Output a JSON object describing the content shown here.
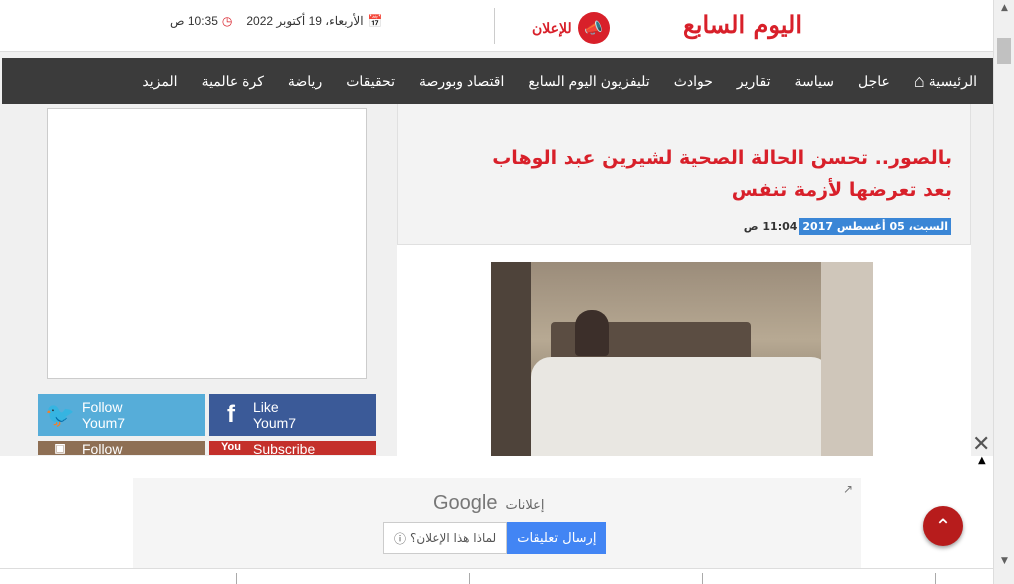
{
  "header": {
    "logo": "اليوم السابع",
    "ad_link_label": "للإعلان",
    "date": "الأربعاء، 19 أكتوبر 2022",
    "time": "10:35 ص",
    "calendar_icon": "calendar-icon",
    "clock_icon": "clock-icon"
  },
  "nav": {
    "items": [
      "الرئيسية",
      "عاجل",
      "سياسة",
      "تقارير",
      "حوادث",
      "تليفزيون اليوم السابع",
      "اقتصاد وبورصة",
      "تحقيقات",
      "رياضة",
      "كرة عالمية",
      "المزيد"
    ]
  },
  "article": {
    "title": "بالصور.. تحسن الحالة الصحية لشيرين عبد الوهاب بعد تعرضها لأزمة تنفس",
    "date": "السبت، 05 أغسطس 2017",
    "time": "11:04 ص"
  },
  "social": {
    "twitter": {
      "line1": "Follow",
      "line2": "Youm7"
    },
    "facebook": {
      "line1": "Like",
      "line2": "Youm7"
    },
    "instagram": {
      "line1": "Follow"
    },
    "youtube": {
      "line1": "Subscribe",
      "icon": "You"
    }
  },
  "ad": {
    "ads_label": "إعلانات",
    "google": "Google",
    "send_feedback": "إرسال تعليقات",
    "why_ad": "لماذا هذا الإعلان؟"
  },
  "colors": {
    "brand": "#d8202a",
    "nav_bg": "#3b3b3b",
    "date_highlight": "#3a86d6"
  }
}
